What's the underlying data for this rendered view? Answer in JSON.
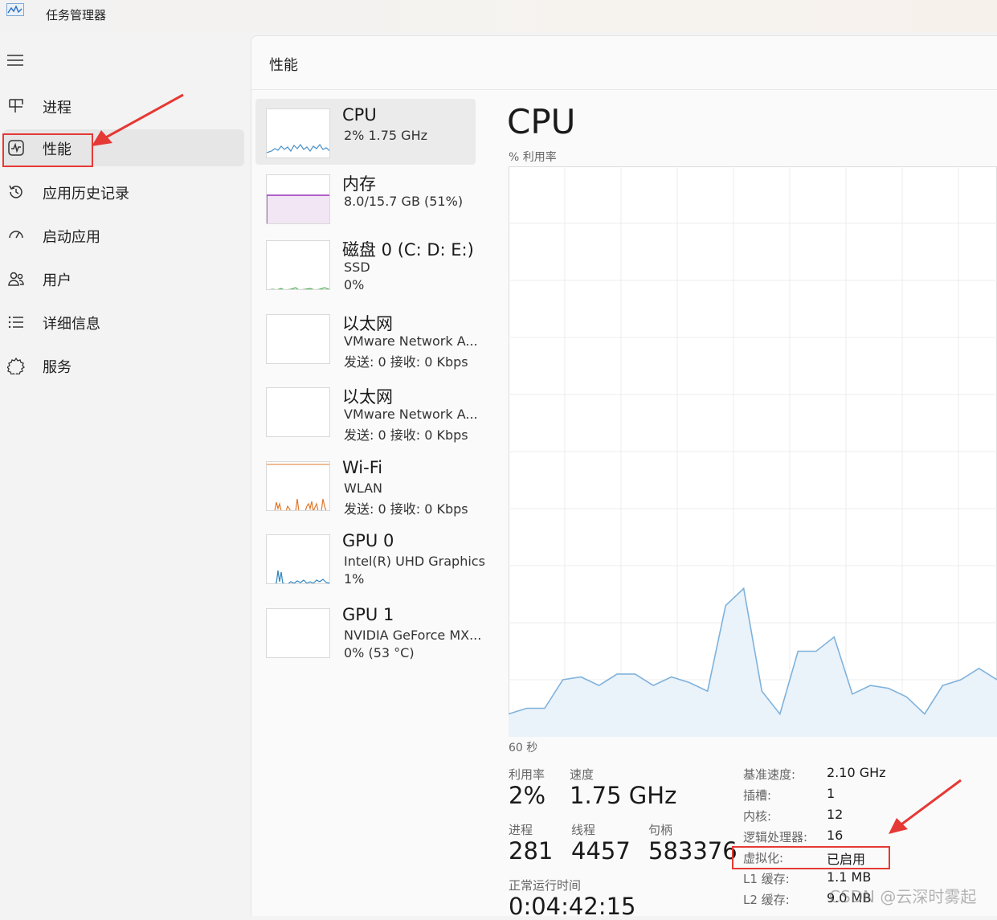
{
  "window": {
    "title": "任务管理器",
    "icon": "task-manager-icon"
  },
  "sidebar": {
    "menu_icon": "hamburger-icon",
    "items": [
      {
        "label": "进程",
        "icon": "process-grid-icon",
        "active": false
      },
      {
        "label": "性能",
        "icon": "performance-chart-icon",
        "active": true
      },
      {
        "label": "应用历史记录",
        "icon": "history-icon",
        "active": false
      },
      {
        "label": "启动应用",
        "icon": "startup-speedometer-icon",
        "active": false
      },
      {
        "label": "用户",
        "icon": "users-icon",
        "active": false
      },
      {
        "label": "详细信息",
        "icon": "details-list-icon",
        "active": false
      },
      {
        "label": "服务",
        "icon": "services-gear-icon",
        "active": false
      }
    ]
  },
  "main": {
    "title": "性能",
    "devices": [
      {
        "name": "CPU",
        "lines": [
          "2% 1.75 GHz"
        ],
        "color": "#4a90c8",
        "selected": true
      },
      {
        "name": "内存",
        "lines": [
          "8.0/15.7 GB (51%)"
        ],
        "color": "#9b30b8",
        "selected": false
      },
      {
        "name": "磁盘 0 (C: D: E:)",
        "lines": [
          "SSD",
          "0%"
        ],
        "color": "#4caf50",
        "selected": false
      },
      {
        "name": "以太网",
        "lines": [
          "VMware Network A...",
          "发送: 0 接收: 0 Kbps"
        ],
        "color": "#c0c0c0",
        "selected": false
      },
      {
        "name": "以太网",
        "lines": [
          "VMware Network A...",
          "发送: 0 接收: 0 Kbps"
        ],
        "color": "#c0c0c0",
        "selected": false
      },
      {
        "name": "Wi-Fi",
        "lines": [
          "WLAN",
          "发送: 0 接收: 0 Kbps"
        ],
        "color": "#e07a2e",
        "selected": false
      },
      {
        "name": "GPU 0",
        "lines": [
          "Intel(R) UHD Graphics",
          "1%"
        ],
        "color": "#2e86c1",
        "selected": false
      },
      {
        "name": "GPU 1",
        "lines": [
          "NVIDIA GeForce MX...",
          "0% (53 °C)"
        ],
        "color": "#c0c0c0",
        "selected": false
      }
    ],
    "cpu": {
      "heading": "CPU",
      "util_caption": "% 利用率",
      "time_caption": "60 秒",
      "graph_color": "#7fb2dc",
      "graph_fill": "#eaf2fa",
      "utilization_series_percent": [
        4,
        5,
        5,
        10,
        10.5,
        9,
        11,
        11,
        9,
        10.5,
        9.5,
        8,
        23,
        26,
        8,
        4,
        15,
        15,
        17.5,
        7.5,
        9,
        8.5,
        7,
        4,
        9,
        10,
        12,
        10
      ],
      "stats": {
        "utilization_label": "利用率",
        "utilization_value": "2%",
        "speed_label": "速度",
        "speed_value": "1.75 GHz",
        "processes_label": "进程",
        "processes_value": "281",
        "threads_label": "线程",
        "threads_value": "4457",
        "handles_label": "句柄",
        "handles_value": "583376",
        "uptime_label": "正常运行时间",
        "uptime_value": "0:04:42:15"
      },
      "specs": [
        {
          "label": "基准速度:",
          "value": "2.10 GHz"
        },
        {
          "label": "插槽:",
          "value": "1"
        },
        {
          "label": "内核:",
          "value": "12"
        },
        {
          "label": "逻辑处理器:",
          "value": "16"
        },
        {
          "label": "虚拟化:",
          "value": "已启用"
        },
        {
          "label": "L1 缓存:",
          "value": "1.1 MB"
        },
        {
          "label": "L2 缓存:",
          "value": "9.0 MB"
        }
      ]
    }
  },
  "annotations": {
    "color": "#e53935",
    "watermark": "CSDN @云深时雾起"
  }
}
